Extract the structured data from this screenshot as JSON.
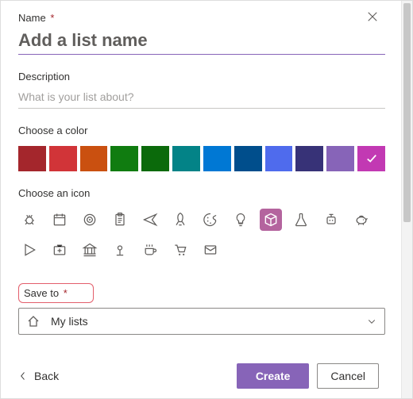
{
  "name": {
    "label": "Name",
    "required_marker": "*",
    "placeholder": "Add a list name",
    "value": ""
  },
  "description": {
    "label": "Description",
    "placeholder": "What is your list about?",
    "value": ""
  },
  "color_section": {
    "label": "Choose a color",
    "colors": [
      "#a4262c",
      "#d13438",
      "#ca5010",
      "#107c10",
      "#0b6a0b",
      "#038387",
      "#0078d4",
      "#004e8c",
      "#4f6bed",
      "#373277",
      "#8764b8",
      "#c239b3"
    ],
    "selected_index": 11
  },
  "icon_section": {
    "label": "Choose an icon",
    "icons_row1": [
      "bug-icon",
      "calendar-icon",
      "target-icon",
      "clipboard-icon",
      "airplane-icon",
      "rocket-icon",
      "palette-icon",
      "lightbulb-icon",
      "cube-icon",
      "flask-icon",
      "robot-icon",
      "piggybank-icon"
    ],
    "icons_row2": [
      "play-icon",
      "firstaid-icon",
      "bank-icon",
      "location-icon",
      "coffee-icon",
      "cart-icon",
      "mail-icon"
    ],
    "selected_name": "cube-icon"
  },
  "saveto": {
    "label": "Save to",
    "required_marker": "*",
    "selected": "My lists"
  },
  "footer": {
    "back": "Back",
    "create": "Create",
    "cancel": "Cancel"
  }
}
